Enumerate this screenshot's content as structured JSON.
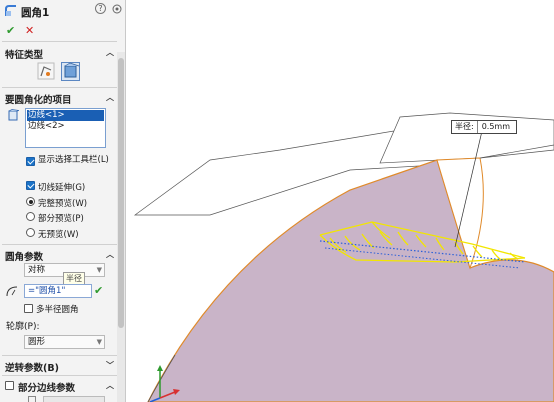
{
  "panel": {
    "title": "圆角1",
    "ok_icon": "✔",
    "cancel_icon": "✕",
    "sections": {
      "feature_type": "特征类型",
      "items": "要圆角化的项目",
      "params": "圆角参数",
      "reverse": "逆转参数(B)",
      "partial": "部分边线参数"
    },
    "edges": [
      "边线<1>",
      "边线<2>"
    ],
    "options": {
      "show_toolbar": "显示选择工具栏(L)",
      "tangent": "切线延伸(G)",
      "full_preview": "完整预览(W)",
      "partial_preview": "部分预览(P)",
      "no_preview": "无预览(W)"
    },
    "symmetric": "对称",
    "radius_label": "半径",
    "radius_value": "=\"圆角1\"",
    "multi_radius": "多半径圆角",
    "profile_label": "轮廓(P):",
    "profile_value": "圆形"
  },
  "callout": {
    "label": "半径:",
    "value": "0.5mm"
  },
  "colors": {
    "selection": "#1a5fb4",
    "face": "#c9b4c8",
    "edge": "#e08a2a",
    "preview": "#f2e600"
  }
}
